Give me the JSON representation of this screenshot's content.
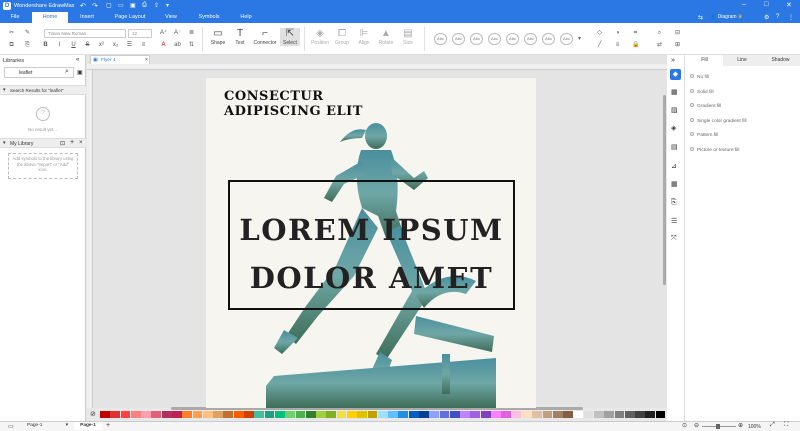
{
  "app": {
    "title": "Wondershare EdrawMax"
  },
  "menu": {
    "items": [
      {
        "label": "File",
        "active": false
      },
      {
        "label": "Home",
        "active": true
      },
      {
        "label": "Insert",
        "active": false
      },
      {
        "label": "Page Layout",
        "active": false
      },
      {
        "label": "View",
        "active": false
      },
      {
        "label": "Symbols",
        "active": false
      },
      {
        "label": "Help",
        "active": false
      }
    ]
  },
  "topright": {
    "diagram_label": "Diagram"
  },
  "ribbon": {
    "font_name": "Times New Roman",
    "font_size": "12",
    "tools": {
      "shape": "Shape",
      "text": "Text",
      "connector": "Connector",
      "select": "Select"
    },
    "arrange": {
      "position": "Position",
      "group": "Group",
      "align": "Align",
      "rotate": "Rotate",
      "size": "Size"
    },
    "style_boxes": [
      "Abc",
      "Abc",
      "Abc",
      "Abc",
      "Abc",
      "Abc",
      "Abc",
      "Abc"
    ]
  },
  "left_panel": {
    "title": "Libraries",
    "search_value": "leaflet",
    "results_header": "Search Results for \"leaflet\"",
    "no_result": "No result yet...",
    "my_library": "My Library",
    "add_hint": "Add symbols to the library using the above \"Import\" or \"Add\" icon."
  },
  "doc_tab": {
    "label": "Flyer 4"
  },
  "flyer": {
    "subtitle_line1": "CONSECTUR",
    "subtitle_line2": "ADIPISCING ELIT",
    "headline_line1": "LOREM IPSUM",
    "headline_line2": "DOLOR AMET"
  },
  "right_panel": {
    "tabs": [
      "Fill",
      "Line",
      "Shadow"
    ],
    "fill_options": [
      "No fill",
      "Solid fill",
      "Gradient fill",
      "Single color gradient fill",
      "Pattern fill",
      "Picture or texture fill"
    ]
  },
  "palette": {
    "colors": [
      "#c00000",
      "#e03030",
      "#ff4040",
      "#ff8080",
      "#ff9fb0",
      "#e0607a",
      "#b03060",
      "#c02050",
      "#ff7f27",
      "#ffa050",
      "#ffc080",
      "#e0a060",
      "#c07030",
      "#ff5c00",
      "#d04000",
      "#40c0a0",
      "#20a080",
      "#00c080",
      "#70d070",
      "#50b050",
      "#308030",
      "#a0d040",
      "#80b020",
      "#f0e040",
      "#ffd000",
      "#e0c000",
      "#c0a000",
      "#a0e0ff",
      "#60c0ff",
      "#2090e0",
      "#0060c0",
      "#004090",
      "#90a0ff",
      "#6070e0",
      "#4050c0",
      "#c080ff",
      "#a060e0",
      "#8040c0",
      "#ff80ff",
      "#e060e0",
      "#ffc0e0",
      "#ffe0c0",
      "#e0c0a0",
      "#c0a080",
      "#a08060",
      "#806040",
      "#ffffff",
      "#e0e0e0",
      "#c0c0c0",
      "#a0a0a0",
      "#808080",
      "#606060",
      "#404040",
      "#202020",
      "#000000"
    ]
  },
  "bottom": {
    "page_select": "Page-1",
    "page_tab": "Page-1",
    "zoom": "100%"
  }
}
